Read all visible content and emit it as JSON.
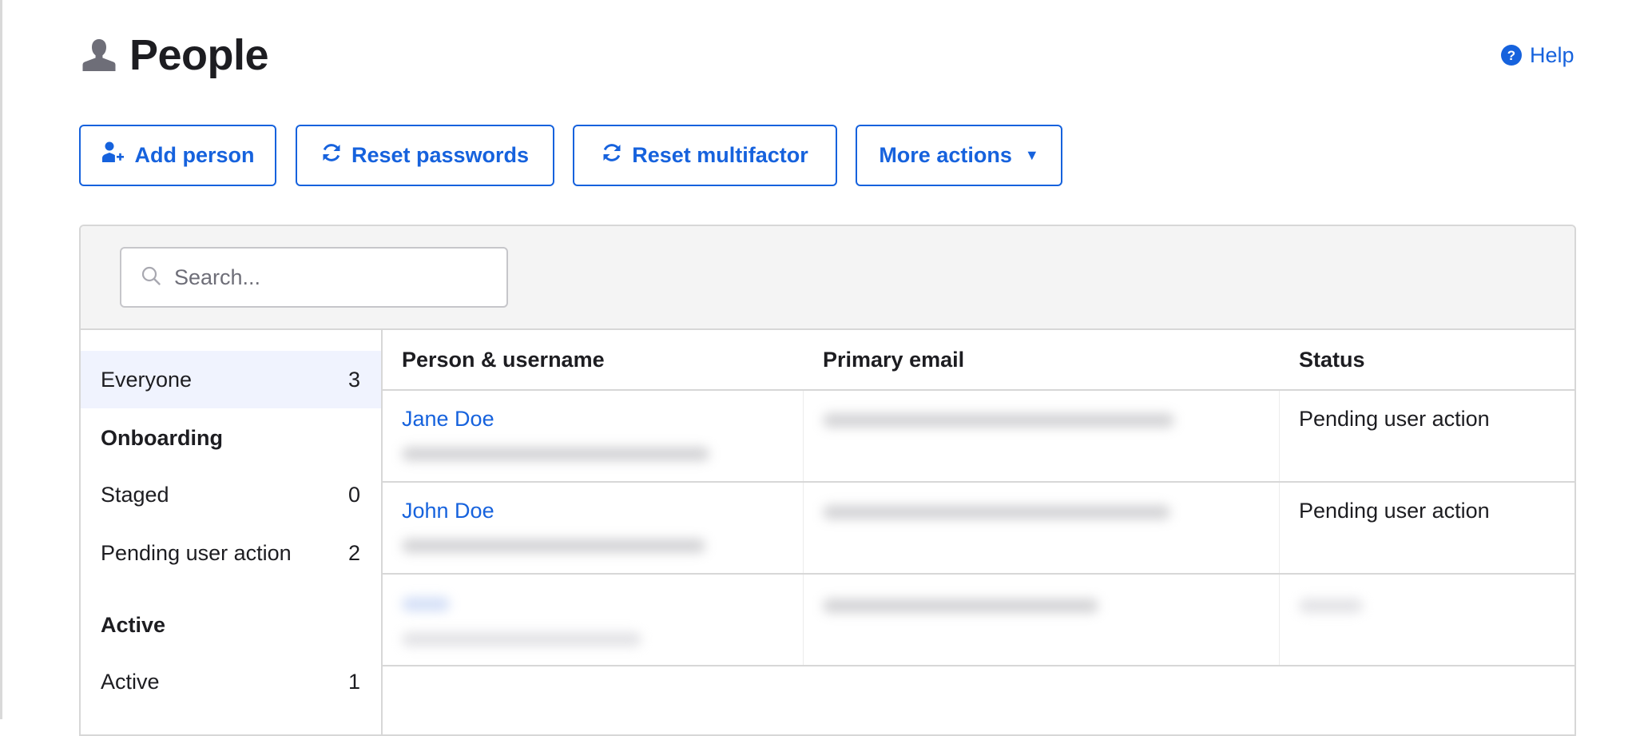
{
  "page": {
    "title": "People",
    "title_icon": "person-icon",
    "help_label": "Help",
    "help_icon": "question-circle-icon"
  },
  "toolbar": {
    "add_person": {
      "label": "Add person",
      "icon": "add-person-icon"
    },
    "reset_passwords": {
      "label": "Reset passwords",
      "icon": "refresh-icon"
    },
    "reset_multifactor": {
      "label": "Reset multifactor",
      "icon": "refresh-icon"
    },
    "more_actions": {
      "label": "More actions",
      "caret": "▼"
    }
  },
  "search": {
    "placeholder": "Search...",
    "value": ""
  },
  "sidebar": {
    "everyone": {
      "label": "Everyone",
      "count": "3",
      "selected": true
    },
    "groups": [
      {
        "heading": "Onboarding",
        "items": [
          {
            "label": "Staged",
            "count": "0"
          },
          {
            "label": "Pending user action",
            "count": "2"
          }
        ]
      },
      {
        "heading": "Active",
        "items": [
          {
            "label": "Active",
            "count": "1"
          }
        ]
      }
    ]
  },
  "table": {
    "columns": [
      "Person & username",
      "Primary email",
      "Status"
    ],
    "rows": [
      {
        "name": "Jane Doe",
        "username": "",
        "email": "",
        "status": "Pending user action",
        "obscured": [
          "username",
          "email"
        ]
      },
      {
        "name": "John Doe",
        "username": "",
        "email": "",
        "status": "Pending user action",
        "obscured": [
          "username",
          "email"
        ]
      },
      {
        "name": "",
        "username": "",
        "email": "",
        "status": "",
        "obscured": [
          "name",
          "username",
          "email",
          "status"
        ]
      }
    ]
  },
  "colors": {
    "accent": "#1662dd",
    "text": "#1d1d21",
    "border": "#d7d7d7",
    "header_bg": "#f4f4f4",
    "selected_bg": "#f0f3fe"
  }
}
